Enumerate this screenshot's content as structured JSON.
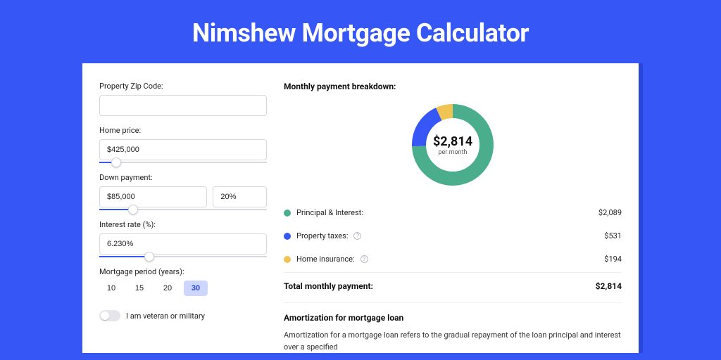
{
  "title": "Nimshew Mortgage Calculator",
  "form": {
    "zip_label": "Property Zip Code:",
    "zip_value": "",
    "home_price_label": "Home price:",
    "home_price_value": "$425,000",
    "home_price_slider_pct": 10,
    "down_payment_label": "Down payment:",
    "down_payment_value": "$85,000",
    "down_payment_pct_value": "20%",
    "down_payment_slider_pct": 20,
    "interest_label": "Interest rate (%):",
    "interest_value": "6.230%",
    "interest_slider_pct": 30,
    "period_label": "Mortgage period (years):",
    "period_options": [
      "10",
      "15",
      "20",
      "30"
    ],
    "period_selected": "30",
    "veteran_label": "I am veteran or military"
  },
  "breakdown": {
    "title": "Monthly payment breakdown:",
    "center_amount": "$2,814",
    "center_sub": "per month",
    "items": [
      {
        "label": "Principal & Interest:",
        "value": "$2,089",
        "color": "#4aae8c",
        "help": false
      },
      {
        "label": "Property taxes:",
        "value": "$531",
        "color": "#3656f5",
        "help": true
      },
      {
        "label": "Home insurance:",
        "value": "$194",
        "color": "#f0c452",
        "help": true
      }
    ],
    "total_label": "Total monthly payment:",
    "total_value": "$2,814"
  },
  "chart_data": {
    "type": "pie",
    "title": "Monthly payment breakdown",
    "series": [
      {
        "name": "Principal & Interest",
        "value": 2089,
        "color": "#4aae8c"
      },
      {
        "name": "Property taxes",
        "value": 531,
        "color": "#3656f5"
      },
      {
        "name": "Home insurance",
        "value": 194,
        "color": "#f0c452"
      }
    ],
    "total": 2814
  },
  "amortization": {
    "title": "Amortization for mortgage loan",
    "text": "Amortization for a mortgage loan refers to the gradual repayment of the loan principal and interest over a specified"
  }
}
